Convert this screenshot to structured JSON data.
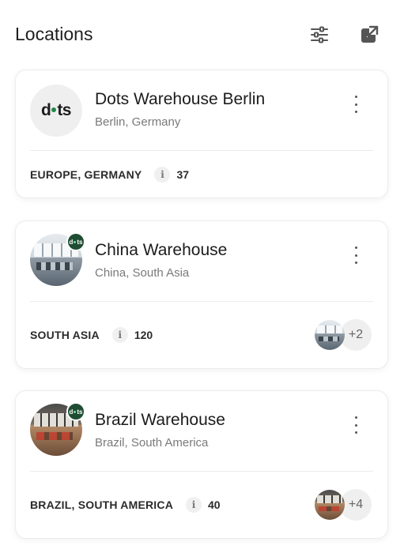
{
  "header": {
    "title": "Locations",
    "filter_icon": "sliders-icon",
    "external_icon": "external-link-icon"
  },
  "locations": [
    {
      "name": "Dots Warehouse Berlin",
      "subtitle": "Berlin, Germany",
      "avatar_type": "logo",
      "logo_text_left": "d",
      "logo_text_right": "ts",
      "region": "EUROPE, GERMANY",
      "count": "37",
      "extra_count": ""
    },
    {
      "name": "China Warehouse",
      "subtitle": "China, South Asia",
      "avatar_type": "photo",
      "region": "SOUTH ASIA",
      "count": "120",
      "extra_count": "+2"
    },
    {
      "name": "Brazil Warehouse",
      "subtitle": "Brazil, South America",
      "avatar_type": "photo",
      "region": "BRAZIL, SOUTH AMERICA",
      "count": "40",
      "extra_count": "+4"
    }
  ],
  "colors": {
    "brand_green": "#1f4d33",
    "logo_dot": "#1f8a4c",
    "card_border": "#ececec"
  }
}
